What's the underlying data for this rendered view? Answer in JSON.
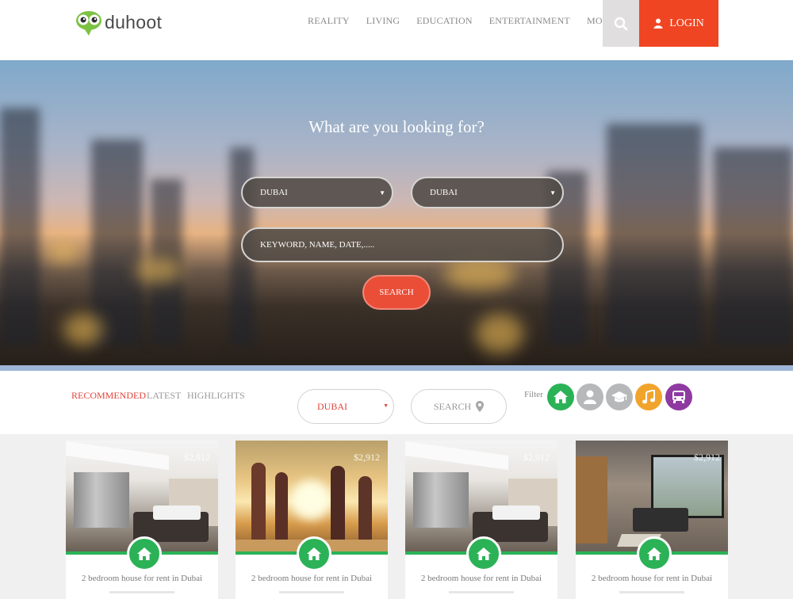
{
  "header": {
    "logo_text": "duhoot",
    "nav": [
      "REALITY",
      "LIVING",
      "EDUCATION",
      "ENTERTAINMENT",
      "MOBILITY"
    ],
    "login_label": "LOGIN",
    "accent": "#f04522"
  },
  "hero": {
    "title": "What are you looking for?",
    "select_1": "DUBAI",
    "select_2": "DUBAI",
    "keyword_placeholder": "KEYWORD, NAME, DATE,.....",
    "search_label": "SEARCH"
  },
  "filter_bar": {
    "tabs": [
      "RECOMMENDED",
      "LATEST",
      "HIGHLIGHTS"
    ],
    "city": "DUBAI",
    "search_label": "SEARCH",
    "filter_label": "Filter",
    "categories": [
      {
        "name": "home-icon",
        "color": "#2bb257"
      },
      {
        "name": "user-icon",
        "color": "#b6b8b9"
      },
      {
        "name": "graduation-cap-icon",
        "color": "#b6b8b9"
      },
      {
        "name": "music-icon",
        "color": "#f1a42b"
      },
      {
        "name": "bus-icon",
        "color": "#8e3aa0"
      }
    ]
  },
  "cards": [
    {
      "price": "$2,912",
      "title": "2 bedroom house for rent in Dubai"
    },
    {
      "price": "$2,912",
      "title": "2 bedroom house for rent in Dubai"
    },
    {
      "price": "$2,912",
      "title": "2 bedroom house for rent in Dubai"
    },
    {
      "price": "$2,912",
      "title": "2 bedroom house for rent in Dubai"
    }
  ]
}
